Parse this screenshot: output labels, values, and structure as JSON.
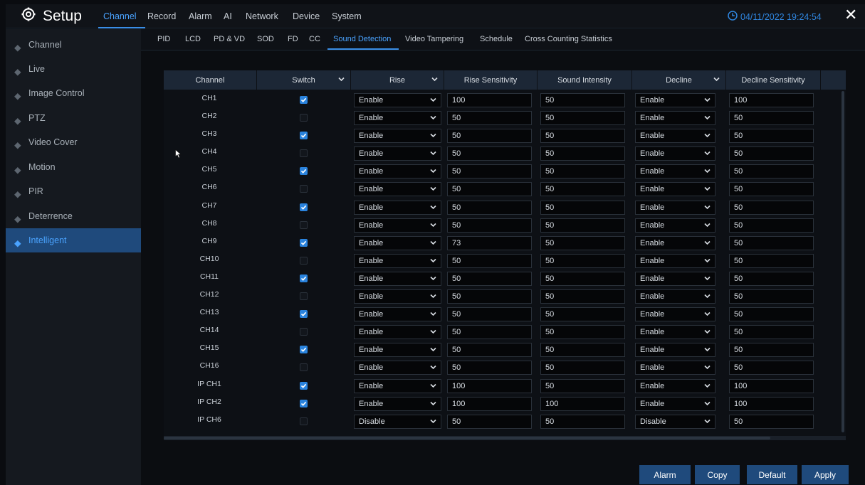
{
  "header": {
    "title": "Setup",
    "datetime": "04/11/2022 19:24:54",
    "tabs": [
      "Channel",
      "Record",
      "Alarm",
      "AI",
      "Network",
      "Device",
      "System"
    ],
    "active_tab": "Channel"
  },
  "sidebar": {
    "items": [
      {
        "label": "Channel"
      },
      {
        "label": "Live"
      },
      {
        "label": "Image Control"
      },
      {
        "label": "PTZ"
      },
      {
        "label": "Video Cover"
      },
      {
        "label": "Motion"
      },
      {
        "label": "PIR"
      },
      {
        "label": "Deterrence"
      },
      {
        "label": "Intelligent",
        "active": true
      }
    ]
  },
  "subtabs": {
    "items": [
      "PID",
      "LCD",
      "PD & VD",
      "SOD",
      "FD",
      "CC",
      "Sound Detection",
      "Video Tampering",
      "Schedule",
      "Cross Counting Statistics"
    ],
    "active": "Sound Detection"
  },
  "table": {
    "columns": [
      "Channel",
      "Switch",
      "Rise",
      "Rise Sensitivity",
      "Sound Intensity",
      "Decline",
      "Decline Sensitivity"
    ],
    "rows": [
      {
        "channel": "CH1",
        "switch": true,
        "rise": "Enable",
        "rise_sensitivity": "100",
        "sound_intensity": "50",
        "decline": "Enable",
        "decline_sensitivity": "100"
      },
      {
        "channel": "CH2",
        "switch": false,
        "rise": "Enable",
        "rise_sensitivity": "50",
        "sound_intensity": "50",
        "decline": "Enable",
        "decline_sensitivity": "50"
      },
      {
        "channel": "CH3",
        "switch": true,
        "rise": "Enable",
        "rise_sensitivity": "50",
        "sound_intensity": "50",
        "decline": "Enable",
        "decline_sensitivity": "50"
      },
      {
        "channel": "CH4",
        "switch": false,
        "rise": "Enable",
        "rise_sensitivity": "50",
        "sound_intensity": "50",
        "decline": "Enable",
        "decline_sensitivity": "50"
      },
      {
        "channel": "CH5",
        "switch": true,
        "rise": "Enable",
        "rise_sensitivity": "50",
        "sound_intensity": "50",
        "decline": "Enable",
        "decline_sensitivity": "50"
      },
      {
        "channel": "CH6",
        "switch": false,
        "rise": "Enable",
        "rise_sensitivity": "50",
        "sound_intensity": "50",
        "decline": "Enable",
        "decline_sensitivity": "50"
      },
      {
        "channel": "CH7",
        "switch": true,
        "rise": "Enable",
        "rise_sensitivity": "50",
        "sound_intensity": "50",
        "decline": "Enable",
        "decline_sensitivity": "50"
      },
      {
        "channel": "CH8",
        "switch": false,
        "rise": "Enable",
        "rise_sensitivity": "50",
        "sound_intensity": "50",
        "decline": "Enable",
        "decline_sensitivity": "50"
      },
      {
        "channel": "CH9",
        "switch": true,
        "rise": "Enable",
        "rise_sensitivity": "73",
        "sound_intensity": "50",
        "decline": "Enable",
        "decline_sensitivity": "50"
      },
      {
        "channel": "CH10",
        "switch": false,
        "rise": "Enable",
        "rise_sensitivity": "50",
        "sound_intensity": "50",
        "decline": "Enable",
        "decline_sensitivity": "50"
      },
      {
        "channel": "CH11",
        "switch": true,
        "rise": "Enable",
        "rise_sensitivity": "50",
        "sound_intensity": "50",
        "decline": "Enable",
        "decline_sensitivity": "50"
      },
      {
        "channel": "CH12",
        "switch": false,
        "rise": "Enable",
        "rise_sensitivity": "50",
        "sound_intensity": "50",
        "decline": "Enable",
        "decline_sensitivity": "50"
      },
      {
        "channel": "CH13",
        "switch": true,
        "rise": "Enable",
        "rise_sensitivity": "50",
        "sound_intensity": "50",
        "decline": "Enable",
        "decline_sensitivity": "50"
      },
      {
        "channel": "CH14",
        "switch": false,
        "rise": "Enable",
        "rise_sensitivity": "50",
        "sound_intensity": "50",
        "decline": "Enable",
        "decline_sensitivity": "50"
      },
      {
        "channel": "CH15",
        "switch": true,
        "rise": "Enable",
        "rise_sensitivity": "50",
        "sound_intensity": "50",
        "decline": "Enable",
        "decline_sensitivity": "50"
      },
      {
        "channel": "CH16",
        "switch": false,
        "rise": "Enable",
        "rise_sensitivity": "50",
        "sound_intensity": "50",
        "decline": "Enable",
        "decline_sensitivity": "50"
      },
      {
        "channel": "IP CH1",
        "switch": true,
        "rise": "Enable",
        "rise_sensitivity": "100",
        "sound_intensity": "50",
        "decline": "Enable",
        "decline_sensitivity": "100"
      },
      {
        "channel": "IP CH2",
        "switch": true,
        "rise": "Enable",
        "rise_sensitivity": "100",
        "sound_intensity": "100",
        "decline": "Enable",
        "decline_sensitivity": "100"
      },
      {
        "channel": "IP CH6",
        "switch": false,
        "rise": "Disable",
        "rise_sensitivity": "50",
        "sound_intensity": "50",
        "decline": "Disable",
        "decline_sensitivity": "50"
      }
    ]
  },
  "footer": {
    "alarm_label": "Alarm",
    "copy_label": "Copy",
    "default_label": "Default",
    "apply_label": "Apply"
  },
  "colors": {
    "accent": "#3a8ee6",
    "active_bg": "#1f4a7c",
    "header_bg": "#1c2736"
  }
}
